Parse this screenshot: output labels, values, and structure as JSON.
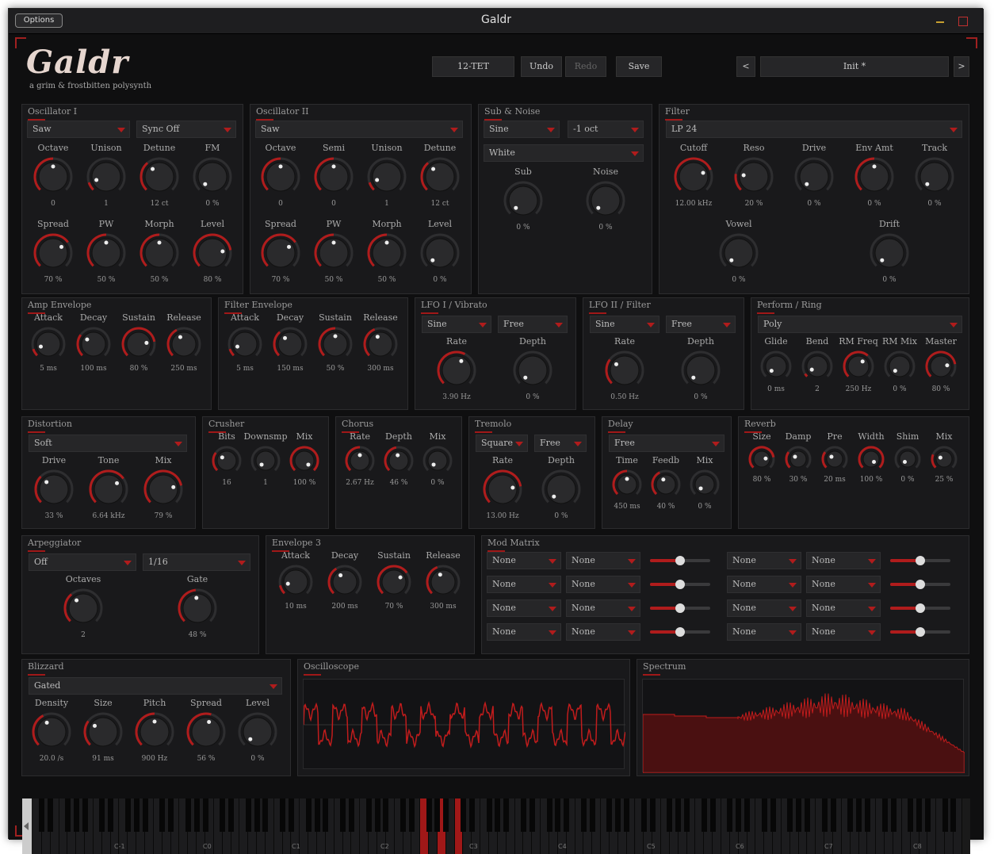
{
  "window": {
    "title": "Galdr",
    "options_label": "Options"
  },
  "header": {
    "logo": "Galdr",
    "tagline": "a grim & frostbitten polysynth",
    "tuning": "12-TET",
    "undo": "Undo",
    "redo": "Redo",
    "save": "Save",
    "preset": "Init *",
    "prev": "<",
    "next": ">"
  },
  "osc1": {
    "title": "Oscillator I",
    "wave": "Saw",
    "sync": "Sync Off",
    "k": [
      [
        "Octave",
        "0",
        0.5
      ],
      [
        "Unison",
        "1",
        0.1
      ],
      [
        "Detune",
        "12 ct",
        0.35
      ],
      [
        "FM",
        "0 %",
        0.0
      ],
      [
        "Spread",
        "70 %",
        0.7
      ],
      [
        "PW",
        "50 %",
        0.5
      ],
      [
        "Morph",
        "50 %",
        0.5
      ],
      [
        "Level",
        "80 %",
        0.8
      ]
    ]
  },
  "osc2": {
    "title": "Oscillator II",
    "wave": "Saw",
    "k": [
      [
        "Octave",
        "0",
        0.5
      ],
      [
        "Semi",
        "0",
        0.5
      ],
      [
        "Unison",
        "1",
        0.1
      ],
      [
        "Detune",
        "12 ct",
        0.35
      ],
      [
        "Spread",
        "70 %",
        0.7
      ],
      [
        "PW",
        "50 %",
        0.5
      ],
      [
        "Morph",
        "50 %",
        0.5
      ],
      [
        "Level",
        "0 %",
        0.0
      ]
    ]
  },
  "subnoise": {
    "title": "Sub & Noise",
    "wave": "Sine",
    "oct": "-1 oct",
    "noise": "White",
    "k": [
      [
        "Sub",
        "0 %",
        0.0
      ],
      [
        "Noise",
        "0 %",
        0.0
      ]
    ]
  },
  "filter": {
    "title": "Filter",
    "type": "LP 24",
    "k": [
      [
        "Cutoff",
        "12.00 kHz",
        0.75
      ],
      [
        "Reso",
        "20 %",
        0.2
      ],
      [
        "Drive",
        "0 %",
        0.0
      ],
      [
        "Env Amt",
        "0 %",
        0.5
      ],
      [
        "Track",
        "0 %",
        0.0
      ],
      [
        "Vowel",
        "0 %",
        0.0
      ],
      [
        "Drift",
        "0 %",
        0.0
      ]
    ]
  },
  "ampenv": {
    "title": "Amp Envelope",
    "k": [
      [
        "Attack",
        "5 ms",
        0.1
      ],
      [
        "Decay",
        "100 ms",
        0.3
      ],
      [
        "Sustain",
        "80 %",
        0.8
      ],
      [
        "Release",
        "250 ms",
        0.4
      ]
    ]
  },
  "filtenv": {
    "title": "Filter Envelope",
    "k": [
      [
        "Attack",
        "5 ms",
        0.1
      ],
      [
        "Decay",
        "150 ms",
        0.35
      ],
      [
        "Sustain",
        "50 %",
        0.5
      ],
      [
        "Release",
        "300 ms",
        0.42
      ]
    ]
  },
  "lfo1": {
    "title": "LFO I / Vibrato",
    "wave": "Sine",
    "mode": "Free",
    "k": [
      [
        "Rate",
        "3.90 Hz",
        0.6
      ],
      [
        "Depth",
        "0 %",
        0.0
      ]
    ]
  },
  "lfo2": {
    "title": "LFO II / Filter",
    "wave": "Sine",
    "mode": "Free",
    "k": [
      [
        "Rate",
        "0.50 Hz",
        0.3
      ],
      [
        "Depth",
        "0 %",
        0.0
      ]
    ]
  },
  "perform": {
    "title": "Perform / Ring",
    "mode": "Poly",
    "k": [
      [
        "Glide",
        "0 ms",
        0.0
      ],
      [
        "Bend",
        "2",
        0.05
      ],
      [
        "RM Freq",
        "250 Hz",
        0.65
      ],
      [
        "RM Mix",
        "0 %",
        0.0
      ],
      [
        "Master",
        "80 %",
        0.8
      ]
    ]
  },
  "dist": {
    "title": "Distortion",
    "mode": "Soft",
    "k": [
      [
        "Drive",
        "33 %",
        0.33
      ],
      [
        "Tone",
        "6.64 kHz",
        0.7
      ],
      [
        "Mix",
        "79 %",
        0.79
      ]
    ]
  },
  "crusher": {
    "title": "Crusher",
    "k": [
      [
        "Bits",
        "16",
        0.3
      ],
      [
        "Downsmp",
        "1",
        0.0
      ],
      [
        "Mix",
        "100 %",
        1.0
      ]
    ]
  },
  "chorus": {
    "title": "Chorus",
    "k": [
      [
        "Rate",
        "2.67 Hz",
        0.5
      ],
      [
        "Depth",
        "46 %",
        0.46
      ],
      [
        "Mix",
        "0 %",
        0.0
      ]
    ]
  },
  "tremolo": {
    "title": "Tremolo",
    "wave": "Square",
    "mode": "Free",
    "k": [
      [
        "Rate",
        "13.00 Hz",
        0.8
      ],
      [
        "Depth",
        "0 %",
        0.0
      ]
    ]
  },
  "delay": {
    "title": "Delay",
    "mode": "Free",
    "k": [
      [
        "Time",
        "450 ms",
        0.5
      ],
      [
        "Feedb",
        "40 %",
        0.4
      ],
      [
        "Mix",
        "0 %",
        0.0
      ]
    ]
  },
  "reverb": {
    "title": "Reverb",
    "k": [
      [
        "Size",
        "80 %",
        0.8
      ],
      [
        "Damp",
        "30 %",
        0.3
      ],
      [
        "Pre",
        "20 ms",
        0.3
      ],
      [
        "Width",
        "100 %",
        1.0
      ],
      [
        "Shim",
        "0 %",
        0.0
      ],
      [
        "Mix",
        "25 %",
        0.25
      ]
    ]
  },
  "arp": {
    "title": "Arpeggiator",
    "mode": "Off",
    "rate": "1/16",
    "k": [
      [
        "Octaves",
        "2",
        0.35
      ],
      [
        "Gate",
        "48 %",
        0.48
      ]
    ]
  },
  "env3": {
    "title": "Envelope 3",
    "k": [
      [
        "Attack",
        "10 ms",
        0.12
      ],
      [
        "Decay",
        "200 ms",
        0.38
      ],
      [
        "Sustain",
        "70 %",
        0.7
      ],
      [
        "Release",
        "300 ms",
        0.42
      ]
    ]
  },
  "modmatrix": {
    "title": "Mod Matrix",
    "src": [
      "None",
      "None",
      "None",
      "None",
      "None",
      "None",
      "None",
      "None"
    ],
    "dst": [
      "None",
      "None",
      "None",
      "None",
      "None",
      "None",
      "None",
      "None"
    ],
    "amount": [
      0.5,
      0.5,
      0.5,
      0.5,
      0.5,
      0.5,
      0.5,
      0.5
    ]
  },
  "blizzard": {
    "title": "Blizzard",
    "mode": "Gated",
    "k": [
      [
        "Density",
        "20.0 /s",
        0.4
      ],
      [
        "Size",
        "91 ms",
        0.3
      ],
      [
        "Pitch",
        "900 Hz",
        0.5
      ],
      [
        "Spread",
        "56 %",
        0.56
      ],
      [
        "Level",
        "0 %",
        0.0
      ]
    ]
  },
  "scope": {
    "title": "Oscilloscope"
  },
  "spectrum": {
    "title": "Spectrum"
  },
  "keyboard": {
    "labels": [
      "C-1",
      "C0",
      "C1",
      "C2",
      "C3",
      "C4",
      "C5",
      "C6",
      "C7",
      "C8"
    ]
  },
  "colors": {
    "accent": "#b01c1c",
    "bg": "#0f0f10",
    "panel": "#19191b"
  }
}
